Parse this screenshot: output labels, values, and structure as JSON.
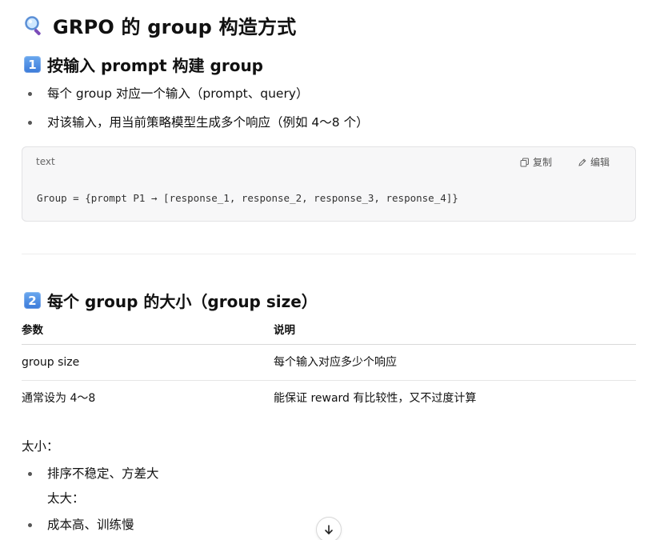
{
  "title": "GRPO 的 group 构造方式",
  "section1": {
    "badge": "1",
    "heading": "按输入 prompt 构建 group",
    "bullets": [
      "每个 group 对应一个输入（prompt、query）",
      "对该输入，用当前策略模型生成多个响应（例如 4～8 个）"
    ]
  },
  "codeblock": {
    "lang": "text",
    "copy_label": "复制",
    "edit_label": "编辑",
    "code": "Group = {prompt P1 → [response_1, response_2, response_3, response_4]}"
  },
  "section2": {
    "badge": "2",
    "heading": "每个 group 的大小（group size）",
    "table": {
      "headers": [
        "参数",
        "说明"
      ],
      "rows": [
        [
          "group size",
          "每个输入对应多少个响应"
        ],
        [
          "通常设为 4～8",
          "能保证 reward 有比较性，又不过度计算"
        ]
      ]
    },
    "too_small_label": "太小：",
    "too_small_bullets": [
      "排序不稳定、方差大"
    ],
    "too_large_label": "太大：",
    "too_large_bullets": [
      "成本高、训练慢"
    ]
  },
  "colors": {
    "badge": "#3b7ad9",
    "border": "#e2e2e5",
    "code_bg": "#f7f7f8"
  }
}
